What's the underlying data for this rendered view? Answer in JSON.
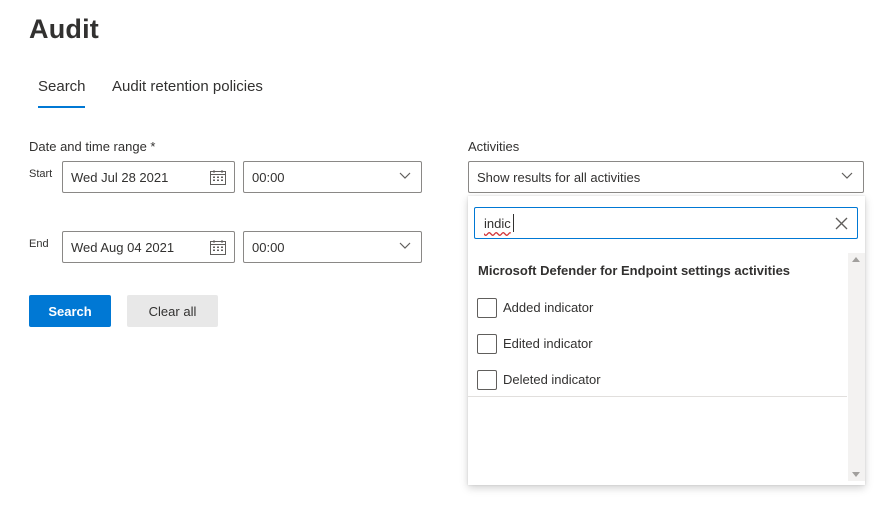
{
  "page": {
    "title": "Audit"
  },
  "tabs": [
    {
      "label": "Search",
      "selected": true
    },
    {
      "label": "Audit retention policies",
      "selected": false
    }
  ],
  "date_range": {
    "label": "Date and time range *",
    "start": {
      "label": "Start",
      "date": "Wed Jul 28 2021",
      "time": "00:00"
    },
    "end": {
      "label": "End",
      "date": "Wed Aug 04 2021",
      "time": "00:00"
    }
  },
  "activities": {
    "label": "Activities",
    "selected_value": "Show results for all activities",
    "filter": {
      "query": "indic"
    },
    "group_header": "Microsoft Defender for Endpoint settings activities",
    "options": [
      {
        "label": "Added indicator",
        "checked": false
      },
      {
        "label": "Edited indicator",
        "checked": false
      },
      {
        "label": "Deleted indicator",
        "checked": false
      }
    ]
  },
  "buttons": {
    "search": "Search",
    "clear": "Clear all"
  },
  "colors": {
    "accent": "#0078d4",
    "text": "#323130",
    "border": "#8a8886",
    "secondary_button": "#e8e8e8"
  },
  "icons": [
    "calendar-icon",
    "chevron-down-icon",
    "clear-icon",
    "scroll-up-icon",
    "scroll-down-icon"
  ]
}
